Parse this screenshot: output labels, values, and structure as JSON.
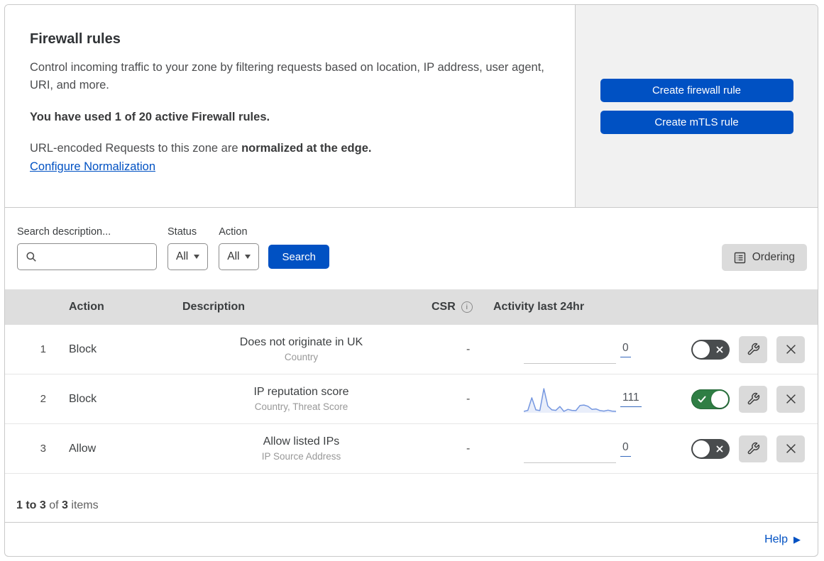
{
  "header": {
    "title": "Firewall rules",
    "description": "Control incoming traffic to your zone by filtering requests based on location, IP address, user agent, URI, and more.",
    "usage": "You have used 1 of 20 active Firewall rules.",
    "normalization_prefix": "URL-encoded Requests to this zone are ",
    "normalization_bold": "normalized at the edge.",
    "normalization_link": "Configure Normalization",
    "create_firewall_button": "Create firewall rule",
    "create_mtls_button": "Create mTLS rule"
  },
  "filters": {
    "search_label": "Search description...",
    "search_value": "",
    "status_label": "Status",
    "status_value": "All",
    "action_label": "Action",
    "action_value": "All",
    "search_button": "Search",
    "ordering_button": "Ordering"
  },
  "table": {
    "headers": {
      "action": "Action",
      "description": "Description",
      "csr": "CSR",
      "activity": "Activity last 24hr"
    },
    "rows": [
      {
        "priority": "1",
        "action": "Block",
        "description": "Does not originate in UK",
        "fields": "Country",
        "csr": "-",
        "activity_count": "0",
        "enabled": false,
        "sparkline": []
      },
      {
        "priority": "2",
        "action": "Block",
        "description": "IP reputation score",
        "fields": "Country, Threat Score",
        "csr": "-",
        "activity_count": "111",
        "enabled": true,
        "sparkline": [
          6,
          10,
          62,
          12,
          9,
          100,
          28,
          12,
          10,
          26,
          6,
          14,
          10,
          9,
          30,
          32,
          27,
          14,
          16,
          9,
          7,
          11,
          7,
          6
        ]
      },
      {
        "priority": "3",
        "action": "Allow",
        "description": "Allow listed IPs",
        "fields": "IP Source Address",
        "csr": "-",
        "activity_count": "0",
        "enabled": false,
        "sparkline": []
      }
    ]
  },
  "footer": {
    "range_bold": "1 to 3",
    "of_text": " of ",
    "total_bold": "3",
    "items_text": " items"
  },
  "help": {
    "label": "Help",
    "arrow_glyph": "▶"
  },
  "icons": {
    "search": "magnifier-glyph",
    "dropdown_caret": "▾",
    "ordering": "list-document-glyph",
    "info": "i",
    "wrench": "spanner-glyph",
    "close": "✕",
    "toggle_on": "✓",
    "toggle_off": "✕"
  },
  "colors": {
    "accent_blue": "#0051c3",
    "toggle_on_green": "#2f7e44",
    "toggle_off_gray": "#494c4e",
    "sparkline_blue": "#7597e0",
    "panel_gray": "#f1f1f1",
    "table_header_gray": "#dedede"
  }
}
